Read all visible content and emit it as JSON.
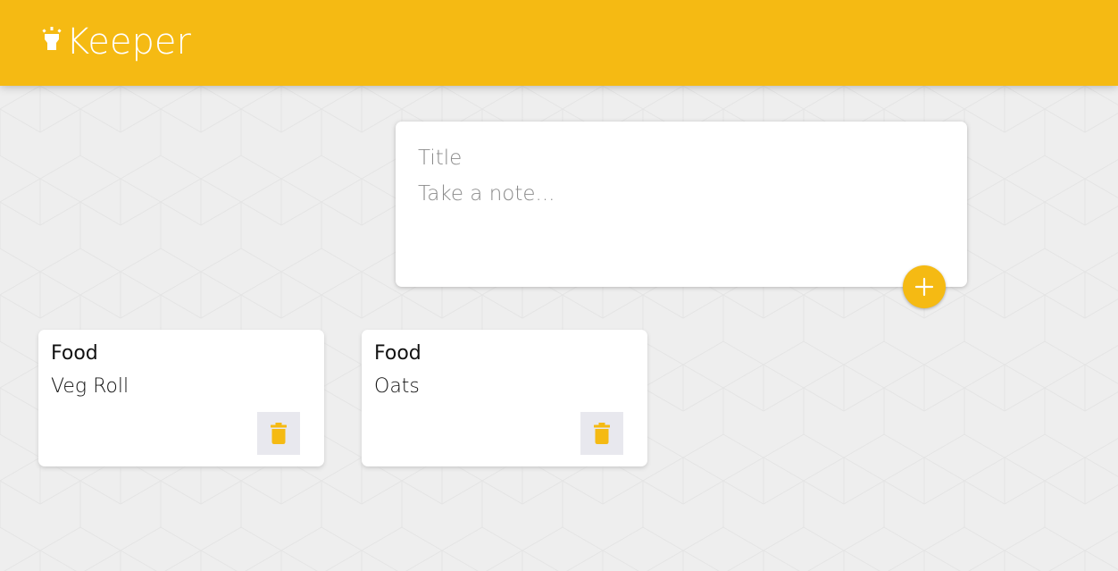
{
  "header": {
    "app_name": "Keeper",
    "logo_icon": "lightbulb-icon",
    "color": "#f5ba13"
  },
  "create_note": {
    "title_placeholder": "Title",
    "title_value": "",
    "content_placeholder": "Take a note...",
    "content_value": "",
    "add_icon": "plus-icon"
  },
  "notes": [
    {
      "title": "Food",
      "content": "Veg Roll",
      "delete_icon": "trash-icon"
    },
    {
      "title": "Food",
      "content": "Oats",
      "delete_icon": "trash-icon"
    }
  ],
  "colors": {
    "accent": "#f5ba13",
    "background": "#eeeeee",
    "card": "#ffffff",
    "delete_button_bg": "#e8e8ee"
  }
}
